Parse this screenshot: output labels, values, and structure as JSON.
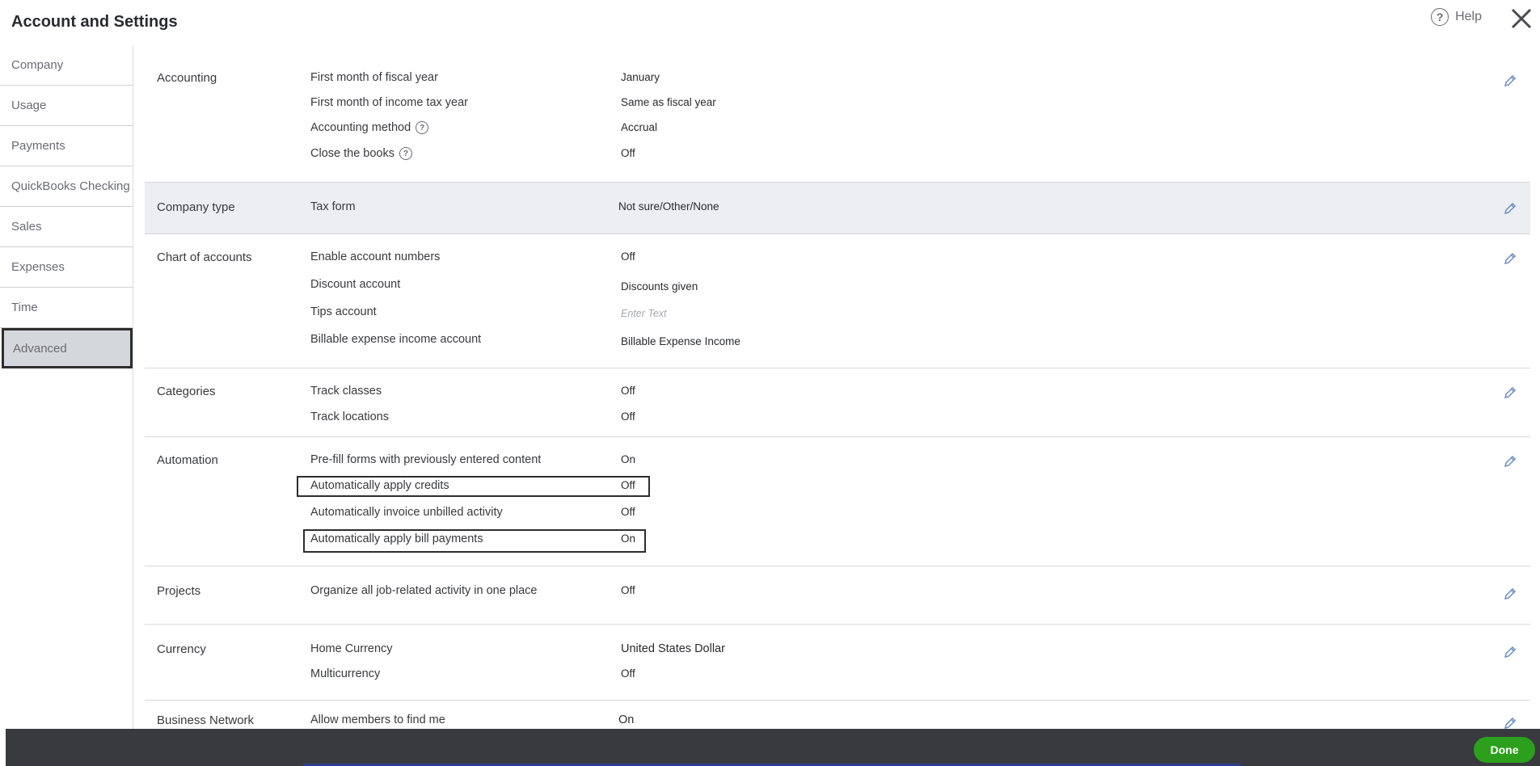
{
  "page": {
    "title": "Account and Settings",
    "help_label": "Help",
    "help_glyph": "?"
  },
  "sidebar": {
    "items": [
      {
        "label": "Company"
      },
      {
        "label": "Usage"
      },
      {
        "label": "Payments"
      },
      {
        "label": "QuickBooks Checking"
      },
      {
        "label": "Sales"
      },
      {
        "label": "Expenses"
      },
      {
        "label": "Time"
      },
      {
        "label": "Advanced",
        "active": true
      }
    ]
  },
  "sections": {
    "accounting": {
      "title": "Accounting",
      "rows": [
        {
          "label": "First month of fiscal year",
          "value": "January"
        },
        {
          "label": "First month of income tax year",
          "value": "Same as fiscal year"
        },
        {
          "label": "Accounting method",
          "value": "Accrual",
          "help": "?"
        },
        {
          "label": "Close the books",
          "value": "Off",
          "help": "?"
        }
      ]
    },
    "company_type": {
      "title": "Company type",
      "rows": [
        {
          "label": "Tax form",
          "value": "Not sure/Other/None"
        }
      ]
    },
    "chart_of_accounts": {
      "title": "Chart of accounts",
      "rows": [
        {
          "label": "Enable account numbers",
          "value": "Off"
        },
        {
          "label": "Discount account",
          "value": "Discounts given"
        },
        {
          "label": "Tips account",
          "placeholder": "Enter Text"
        },
        {
          "label": "Billable expense income account",
          "value": "Billable Expense Income"
        }
      ]
    },
    "categories": {
      "title": "Categories",
      "rows": [
        {
          "label": "Track classes",
          "value": "Off"
        },
        {
          "label": "Track locations",
          "value": "Off"
        }
      ]
    },
    "automation": {
      "title": "Automation",
      "rows": [
        {
          "label": "Pre-fill forms with previously entered content",
          "value": "On"
        },
        {
          "label": "Automatically apply credits",
          "value": "Off"
        },
        {
          "label": "Automatically invoice unbilled activity",
          "value": "Off"
        },
        {
          "label": "Automatically apply bill payments",
          "value": "On"
        }
      ]
    },
    "projects": {
      "title": "Projects",
      "rows": [
        {
          "label": "Organize all job-related activity in one place",
          "value": "Off"
        }
      ]
    },
    "currency": {
      "title": "Currency",
      "rows": [
        {
          "label": "Home Currency",
          "value": "United States Dollar"
        },
        {
          "label": "Multicurrency",
          "value": "Off"
        }
      ]
    },
    "business_network": {
      "title": "Business Network",
      "rows": [
        {
          "label": "Allow members to find me",
          "value": "On"
        }
      ]
    }
  },
  "footer": {
    "done_label": "Done"
  },
  "colors": {
    "accent_green": "#2ca01c",
    "footer_bg": "#393a3d",
    "shaded_row": "#eceef1",
    "pencil": "#6b8cc4"
  }
}
